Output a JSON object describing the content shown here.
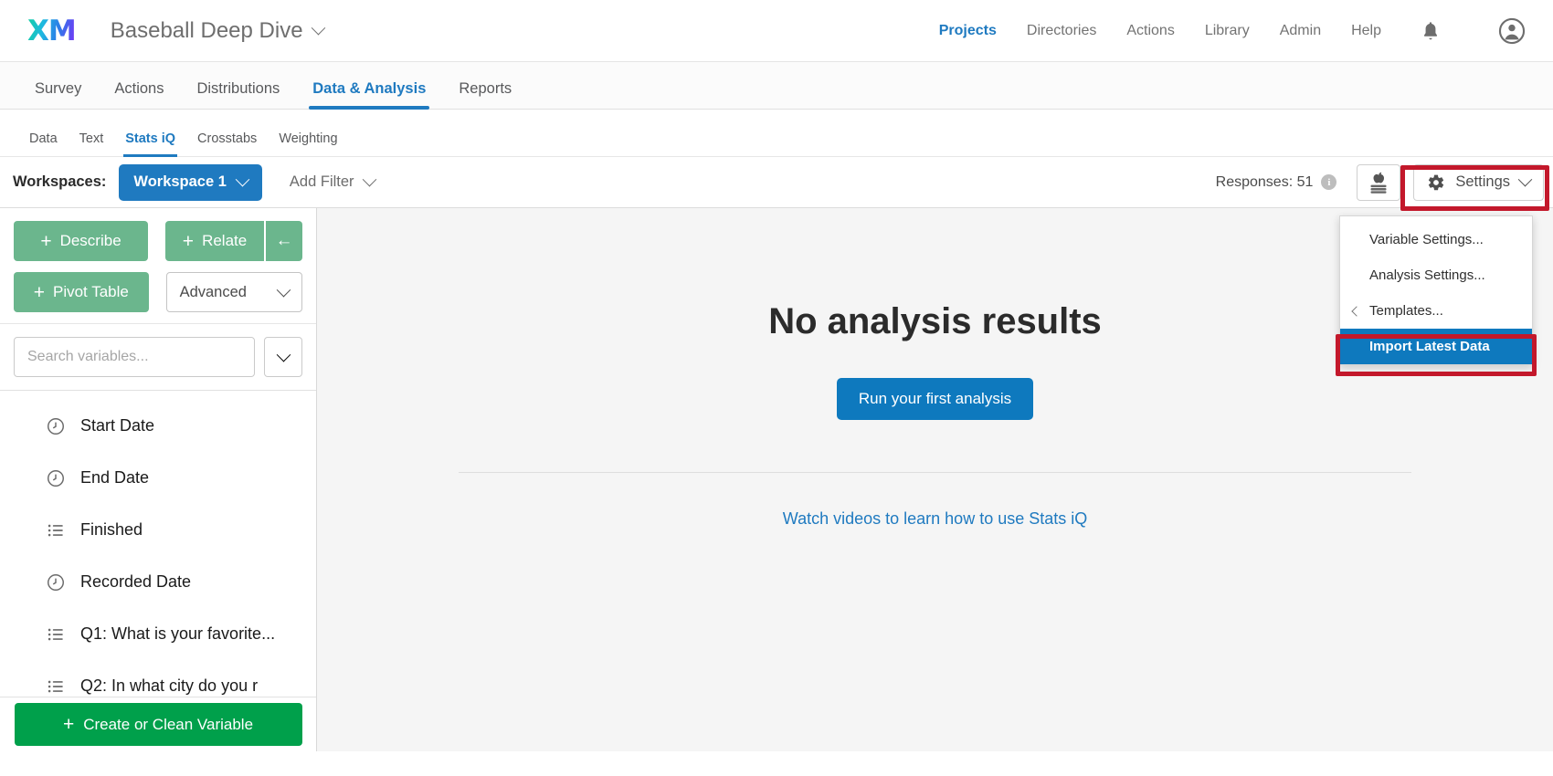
{
  "header": {
    "logo_text": "XM",
    "project_title": "Baseball Deep Dive",
    "nav": [
      {
        "label": "Projects",
        "active": true
      },
      {
        "label": "Directories",
        "active": false
      },
      {
        "label": "Actions",
        "active": false
      },
      {
        "label": "Library",
        "active": false
      },
      {
        "label": "Admin",
        "active": false
      },
      {
        "label": "Help",
        "active": false
      }
    ],
    "bell_icon": "bell-icon",
    "avatar_icon": "account-avatar-icon"
  },
  "tabs": [
    {
      "label": "Survey"
    },
    {
      "label": "Actions"
    },
    {
      "label": "Distributions"
    },
    {
      "label": "Data & Analysis"
    },
    {
      "label": "Reports"
    }
  ],
  "subtabs": [
    {
      "label": "Data"
    },
    {
      "label": "Text"
    },
    {
      "label": "Stats iQ"
    },
    {
      "label": "Crosstabs"
    },
    {
      "label": "Weighting"
    }
  ],
  "workspace_bar": {
    "workspaces_label": "Workspaces:",
    "workspace_name": "Workspace 1",
    "add_filter": "Add Filter",
    "responses_label": "Responses: 51",
    "info_icon": "info-icon",
    "tutorial_icon": "apple-on-books-icon",
    "settings_label": "Settings",
    "settings_icon": "gear-icon"
  },
  "settings_menu": {
    "items": [
      {
        "label": "Variable Settings...",
        "selected": false,
        "submenu": false
      },
      {
        "label": "Analysis Settings...",
        "selected": false,
        "submenu": false
      },
      {
        "label": "Templates...",
        "selected": false,
        "submenu": true
      },
      {
        "label": "Import Latest Data",
        "selected": true,
        "submenu": false
      }
    ]
  },
  "sidebar": {
    "actions": {
      "describe": "Describe",
      "relate": "Relate",
      "back_arrow": "←",
      "pivot_table": "Pivot Table",
      "advanced": "Advanced",
      "plus": "+"
    },
    "search_placeholder": "Search variables...",
    "variables": [
      {
        "label": "Start Date",
        "icon": "date-clock-icon"
      },
      {
        "label": "End Date",
        "icon": "date-clock-icon"
      },
      {
        "label": "Finished",
        "icon": "categorical-list-icon"
      },
      {
        "label": "Recorded Date",
        "icon": "date-clock-icon"
      },
      {
        "label": "Q1: What is your favorite...",
        "icon": "categorical-list-icon"
      },
      {
        "label": "Q2: In what city do you r",
        "icon": "categorical-list-icon"
      }
    ],
    "create_button": "Create or Clean Variable"
  },
  "main": {
    "empty_title": "No analysis results",
    "run_button": "Run your first analysis",
    "videos_link": "Watch videos to learn how to use Stats iQ"
  },
  "colors": {
    "brand_blue": "#1f7ac0",
    "button_blue": "#0e79be",
    "green_action": "#6bb68d",
    "green_create": "#00a04b",
    "highlight_red": "#c3182b"
  }
}
